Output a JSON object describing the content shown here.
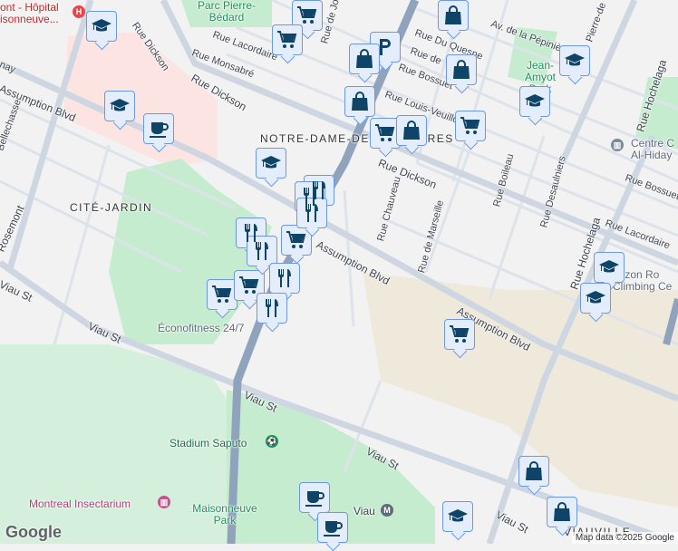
{
  "labels": {
    "hospital": "ont - Hôpital\nisonneuve...",
    "parc_pierre_bedard": "Parc Pierre-Bédard",
    "rue_dickson_n": "Rue Dickson",
    "rue_lacordaire_w": "Rue Lacordaire",
    "rue_monsabre": "Rue Monsabré",
    "rue_dickson_mid": "Rue Dickson",
    "rue_de_jo": "Rue de Jo",
    "assumption_w": "Assumption Blvd",
    "bellechasse": "Bellechasse",
    "nay": "nay",
    "notre_dame": "NOTRE-DAME-DES-VICTOIRES",
    "cite_jardin": "CITÉ-JARDIN",
    "rosemont": "Rosemont",
    "viau_w": "Viau St",
    "viau_w2": "Viau St",
    "assumption_mid": "Assumption Blvd",
    "assumption_e": "Assumption Blvd",
    "rue_du_quesne": "Rue Du Quesne",
    "rue_de": "Rue de",
    "rue_bossuet_w": "Rue Bossuet",
    "rue_louis_veuillot": "Rue Louis-Veuillot",
    "av_pepiniere": "Av. de la Pépinière",
    "pierre_de": "Pierre-de",
    "jean_amyot_park": "Jean-Amyot Park",
    "rue_dickson_e": "Rue Dickson",
    "rue_chauveau": "Rue Chauveau",
    "rue_de_marseille": "Rue de Marseille",
    "rue_boileau": "Rue Boileau",
    "rue_desaulniers": "Rue Desaulniers",
    "rue_hochelaga_n": "Rue Hochelaga",
    "rue_hochelaga": "Rue Hochelaga",
    "centre_al_hidaya": "Centre C\nAl-Hiday",
    "rue_bossuet_e": "Rue Bossuet",
    "rue_lacordaire_e": "Rue Lacordaire",
    "horizon_roc": "orizon Ro\nClimbing Ce",
    "econofitness": "Éconofitness 24/7",
    "viau_mid": "Viau St",
    "stadium_saputo": "Stadium Saputo",
    "viau_se": "Viau St",
    "viau_s": "Viau St",
    "insectarium": "Montreal Insectarium",
    "maisonneuve_park": "Maisonneuve Park",
    "viau_metro": "Viau",
    "viauville": "VIAUVILLE",
    "hospital_icon": "H",
    "metro_icon": "M"
  },
  "google_logo": "Google",
  "attribution": "Map data ©2025 Google",
  "colors": {
    "marker_bg": "#e4edfc",
    "marker_border": "#6c98e3",
    "icon": "#0d4467",
    "park": "#c3ecd2",
    "highway": "#8fa3bd",
    "road": "#d3dbe4"
  }
}
